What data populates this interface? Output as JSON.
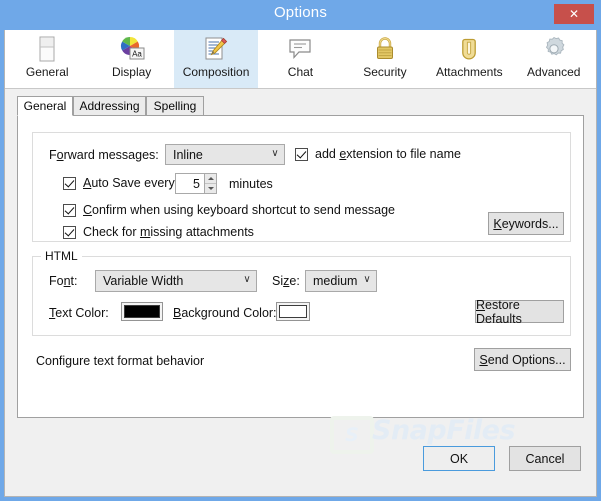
{
  "window": {
    "title": "Options",
    "close_label": "✕",
    "accent_color": "#6fa8e8",
    "close_color": "#c7504b"
  },
  "toolbar": {
    "items": [
      {
        "label": "General",
        "icon": "window-icon",
        "selected": false
      },
      {
        "label": "Display",
        "icon": "color-wheel-icon",
        "selected": false
      },
      {
        "label": "Composition",
        "icon": "document-pencil-icon",
        "selected": true
      },
      {
        "label": "Chat",
        "icon": "speech-bubble-icon",
        "selected": false
      },
      {
        "label": "Security",
        "icon": "padlock-icon",
        "selected": false
      },
      {
        "label": "Attachments",
        "icon": "paperclip-icon",
        "selected": false
      },
      {
        "label": "Advanced",
        "icon": "gear-icon",
        "selected": false
      }
    ],
    "selected_background": "#d9eaf7"
  },
  "tabs": [
    {
      "label": "General",
      "active": true
    },
    {
      "label": "Addressing",
      "active": false
    },
    {
      "label": "Spelling",
      "active": false
    }
  ],
  "general_panel": {
    "forward_messages": {
      "label_pre": "F",
      "label_accel": "o",
      "label_post": "rward messages:",
      "value": "Inline",
      "arrow": "∨"
    },
    "add_extension": {
      "text_pre": "add ",
      "text_accel": "e",
      "text_post": "xtension to file name",
      "checked": true
    },
    "auto_save": {
      "text_pre": "",
      "text_accel": "A",
      "text_post": "uto Save every",
      "checked": true,
      "value": "5",
      "unit": "minutes"
    },
    "confirm_shortcut": {
      "text_pre": "",
      "text_accel": "C",
      "text_post": "onfirm when using keyboard shortcut to send message",
      "checked": true
    },
    "check_missing": {
      "text_pre": "Check for ",
      "text_accel": "m",
      "text_post": "issing attachments",
      "checked": true
    },
    "keywords_button": {
      "label_pre": "",
      "label_accel": "K",
      "label_post": "eywords..."
    }
  },
  "html_group": {
    "legend": "HTML",
    "font": {
      "label_pre": "Fo",
      "label_accel": "n",
      "label_post": "t:",
      "value": "Variable Width",
      "arrow": "∨"
    },
    "size": {
      "label_pre": "Si",
      "label_accel": "z",
      "label_post": "e:",
      "value": "medium",
      "arrow": "∨"
    },
    "text_color": {
      "label_pre": "",
      "label_accel": "T",
      "label_post": "ext Color:",
      "color": "#000000"
    },
    "background_color": {
      "label_pre": "",
      "label_accel": "B",
      "label_post": "ackground Color:",
      "color": "#ffffff"
    },
    "restore_defaults": {
      "label_pre": "",
      "label_accel": "R",
      "label_post": "estore Defaults"
    }
  },
  "footer": {
    "status_text": "Configure text format behavior",
    "send_options": {
      "label_pre": "",
      "label_accel": "S",
      "label_post": "end Options..."
    }
  },
  "watermark": {
    "logo": "S",
    "text": "SnapFiles"
  },
  "dialog_buttons": {
    "ok": "OK",
    "cancel": "Cancel"
  }
}
